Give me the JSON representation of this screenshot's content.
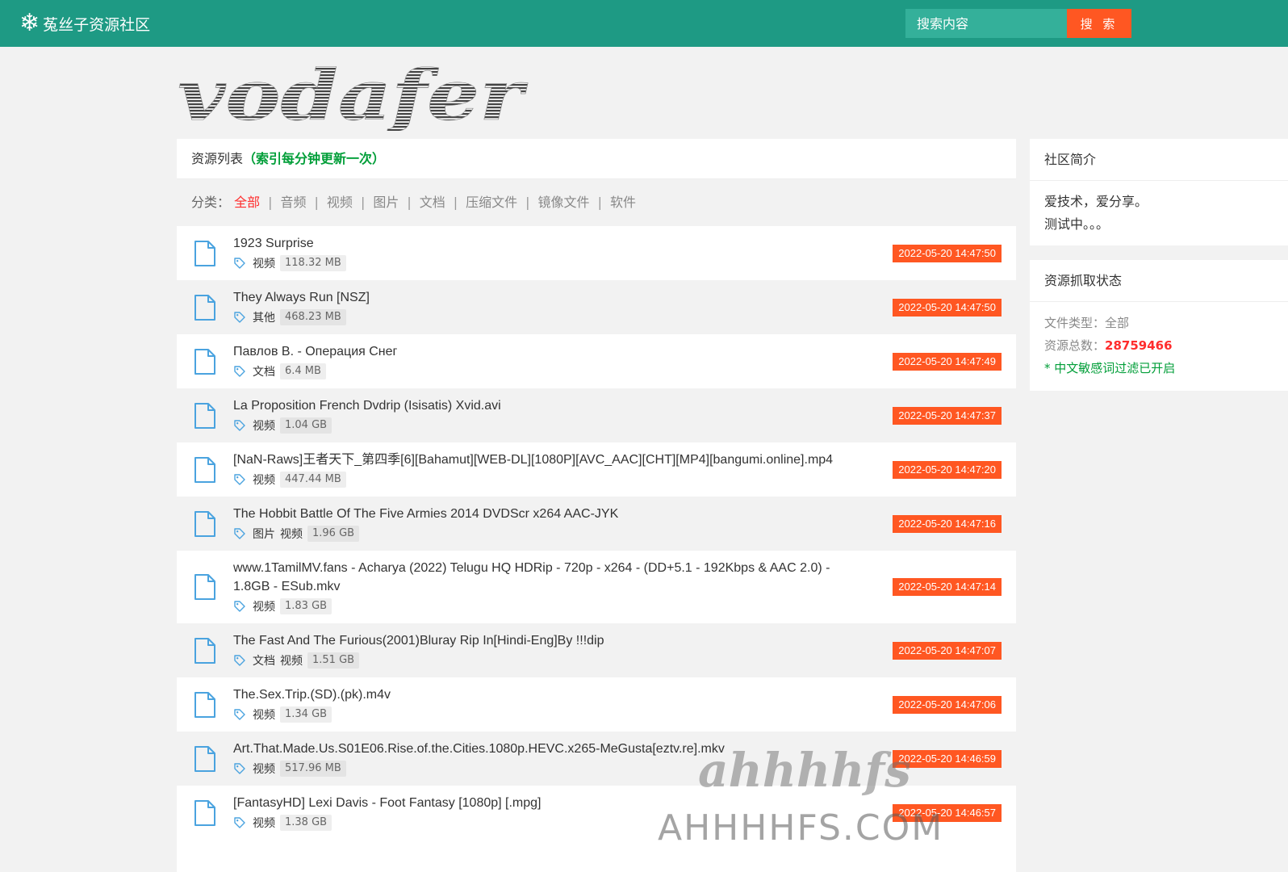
{
  "header": {
    "brand": "菟丝子资源社区",
    "search_placeholder": "搜索内容",
    "search_button": "搜 索",
    "colors": {
      "bar": "#1e9a84",
      "button": "#ff5722"
    }
  },
  "logo": {
    "text": "vodafer"
  },
  "list": {
    "title": "资源列表",
    "note": "（索引每分钟更新一次）",
    "category_label": "分类：",
    "categories": [
      "全部",
      "音频",
      "视频",
      "图片",
      "文档",
      "压缩文件",
      "镜像文件",
      "软件"
    ],
    "active_category": "全部",
    "items": [
      {
        "title": "1923 Surprise",
        "tags": [
          "视频"
        ],
        "size": "118.32 MB",
        "time": "2022-05-20 14:47:50"
      },
      {
        "title": "They Always Run [NSZ]",
        "tags": [
          "其他"
        ],
        "size": "468.23 MB",
        "time": "2022-05-20 14:47:50"
      },
      {
        "title": "Павлов В. - Операция Снег",
        "tags": [
          "文档"
        ],
        "size": "6.4 MB",
        "time": "2022-05-20 14:47:49"
      },
      {
        "title": "La Proposition French Dvdrip (Isisatis) Xvid.avi",
        "tags": [
          "视频"
        ],
        "size": "1.04 GB",
        "time": "2022-05-20 14:47:37"
      },
      {
        "title": "[NaN-Raws]王者天下_第四季[6][Bahamut][WEB-DL][1080P][AVC_AAC][CHT][MP4][bangumi.online].mp4",
        "tags": [
          "视频"
        ],
        "size": "447.44 MB",
        "time": "2022-05-20 14:47:20"
      },
      {
        "title": "The Hobbit Battle Of The Five Armies 2014 DVDScr x264 AAC-JYK",
        "tags": [
          "图片",
          "视频"
        ],
        "size": "1.96 GB",
        "time": "2022-05-20 14:47:16"
      },
      {
        "title": "www.1TamilMV.fans - Acharya (2022) Telugu HQ HDRip - 720p - x264 - (DD+5.1 - 192Kbps & AAC 2.0) - 1.8GB - ESub.mkv",
        "tags": [
          "视频"
        ],
        "size": "1.83 GB",
        "time": "2022-05-20 14:47:14"
      },
      {
        "title": "The Fast And The Furious(2001)Bluray Rip In[Hindi-Eng]By !!!dip",
        "tags": [
          "文档",
          "视频"
        ],
        "size": "1.51 GB",
        "time": "2022-05-20 14:47:07"
      },
      {
        "title": "The.Sex.Trip.(SD).(pk).m4v",
        "tags": [
          "视频"
        ],
        "size": "1.34 GB",
        "time": "2022-05-20 14:47:06"
      },
      {
        "title": "Art.That.Made.Us.S01E06.Rise.of.the.Cities.1080p.HEVC.x265-MeGusta[eztv.re].mkv",
        "tags": [
          "视频"
        ],
        "size": "517.96 MB",
        "time": "2022-05-20 14:46:59"
      },
      {
        "title": "[FantasyHD] Lexi Davis - Foot Fantasy [1080p] [.mpg]",
        "tags": [
          "视频"
        ],
        "size": "1.38 GB",
        "time": "2022-05-20 14:46:57"
      }
    ]
  },
  "sidebar": {
    "about": {
      "title": "社区简介",
      "line1": "爱技术，爱分享。",
      "line2": "测试中。。。"
    },
    "status": {
      "title": "资源抓取状态",
      "type_label": "文件类型：",
      "type_value": "全部",
      "total_label": "资源总数：",
      "total_value": "28759466",
      "filter_note": "* 中文敏感词过滤已开启"
    }
  },
  "watermark": {
    "script": "ahhhhfs",
    "domain": "AHHHHFS.COM"
  }
}
